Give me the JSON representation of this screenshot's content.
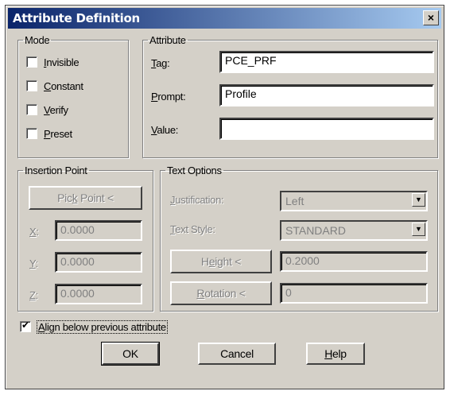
{
  "window": {
    "title": "Attribute Definition",
    "close_glyph": "×"
  },
  "mode": {
    "legend": "Mode",
    "options": [
      {
        "label": "Invisible",
        "mnemonic": "I",
        "rest": "nvisible",
        "checked": false
      },
      {
        "label": "Constant",
        "mnemonic": "C",
        "rest": "onstant",
        "checked": false
      },
      {
        "label": "Verify",
        "mnemonic": "V",
        "rest": "erify",
        "checked": false
      },
      {
        "label": "Preset",
        "mnemonic": "P",
        "rest": "reset",
        "checked": false
      }
    ]
  },
  "attribute": {
    "legend": "Attribute",
    "tag": {
      "label_mn": "T",
      "label_rest": "ag:",
      "value": "PCE_PRF"
    },
    "prompt": {
      "label_mn": "P",
      "label_rest": "rompt:",
      "value": "Profile"
    },
    "value": {
      "label_mn": "V",
      "label_rest": "alue:",
      "value": ""
    }
  },
  "insertion_point": {
    "legend": "Insertion Point",
    "pick_point": {
      "mn_pre": "Pic",
      "mn": "k",
      "post": " Point <"
    },
    "x": {
      "label_mn": "X",
      "label_rest": ":",
      "value": "0.0000"
    },
    "y": {
      "label_mn": "Y",
      "label_rest": ":",
      "value": "0.0000"
    },
    "z": {
      "label_mn": "Z",
      "label_rest": ":",
      "value": "0.0000"
    }
  },
  "text_options": {
    "legend": "Text Options",
    "justification": {
      "label_mn": "J",
      "label_rest": "ustification:",
      "value": "Left"
    },
    "text_style": {
      "label_mn": "T",
      "label_rest": "ext Style:",
      "value": "STANDARD"
    },
    "height": {
      "button_pre": "H",
      "button_mn": "e",
      "button_post": "ight <",
      "value": "0.2000"
    },
    "rotation": {
      "button_mn": "R",
      "button_post": "otation <",
      "value": "0"
    }
  },
  "align_below": {
    "mn": "A",
    "rest": "lign below previous attribute",
    "checked": true
  },
  "buttons": {
    "ok": "OK",
    "cancel": "Cancel",
    "help_mn": "H",
    "help_rest": "elp"
  }
}
